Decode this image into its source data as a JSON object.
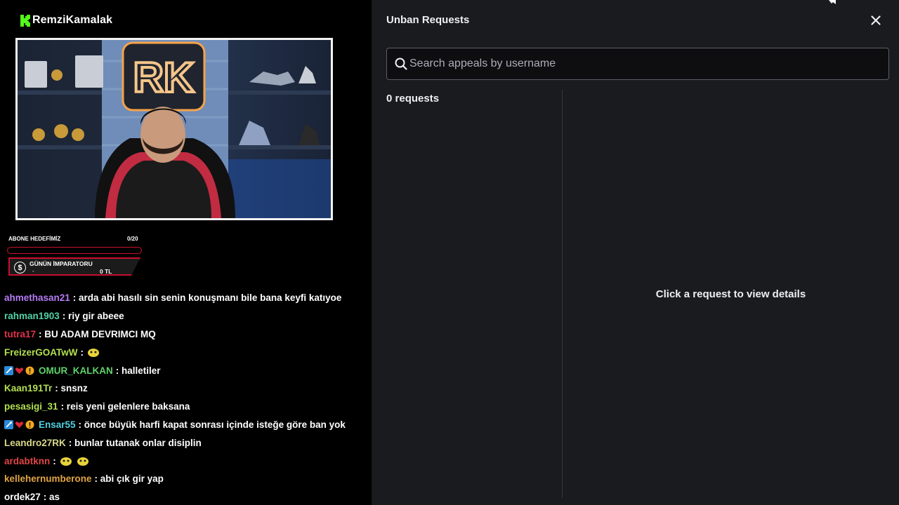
{
  "stream": {
    "brand_name": "RemziKamalak",
    "overlay": {
      "goal_label": "ABONE HEDEFİMİZ",
      "goal_count": "0/20",
      "goal_progress": 0,
      "emperor_title": "GÜNÜN İMPARATORU",
      "emperor_user": "-",
      "emperor_amount": "0 TL"
    },
    "chat": [
      {
        "user": "ahmethasan21",
        "color": "#b57cf5",
        "message": ": arda abi hasılı sin senin konuşmanı bile bana keyfi katıyoe",
        "badges": [],
        "emotes": 0
      },
      {
        "user": "rahman1903",
        "color": "#53d1a8",
        "message": ": riy gir abeee",
        "badges": [],
        "emotes": 0
      },
      {
        "user": "tutra17",
        "color": "#e0314b",
        "message": ": BU ADAM DEVRIMCI MQ",
        "badges": [],
        "emotes": 0
      },
      {
        "user": "FreizerGOATwW",
        "color": "#b2e04f",
        "message": ":",
        "badges": [],
        "emotes": 1
      },
      {
        "user": "OMUR_KALKAN",
        "color": "#5fd36b",
        "message": ": halletiler",
        "badges": [
          "sword",
          "heart",
          "warn"
        ],
        "emotes": 0
      },
      {
        "user": "Kaan191Tr",
        "color": "#b2e04f",
        "message": ": snsnz",
        "badges": [],
        "emotes": 0
      },
      {
        "user": "pesasigi_31",
        "color": "#b2e04f",
        "message": ": reis yeni gelenlere baksana",
        "badges": [],
        "emotes": 0
      },
      {
        "user": "Ensar55",
        "color": "#53d1e0",
        "message": ": önce büyük harfi kapat sonrası içinde isteğe göre ban yok",
        "badges": [
          "sword",
          "heart",
          "warn"
        ],
        "emotes": 0
      },
      {
        "user": "Leandro27RK",
        "color": "#d9d98c",
        "message": ": bunlar tutanak onlar disiplin",
        "badges": [],
        "emotes": 0
      },
      {
        "user": "ardabtknn",
        "color": "#e04545",
        "message": ":",
        "badges": [],
        "emotes": 2
      },
      {
        "user": "kellehernumberone",
        "color": "#e0a545",
        "message": ": abi çık gir yap",
        "badges": [],
        "emotes": 0
      },
      {
        "user": "ordek27",
        "color": "#fff",
        "message": ": as",
        "badges": [],
        "emotes": 0
      }
    ]
  },
  "panel": {
    "title": "Unban Requests",
    "search": {
      "placeholder": "Search appeals by username",
      "value": ""
    },
    "requests_count": "0 requests",
    "empty_detail": "Click a request to view details",
    "icons": {
      "close": "close-icon",
      "search": "search-icon"
    }
  }
}
